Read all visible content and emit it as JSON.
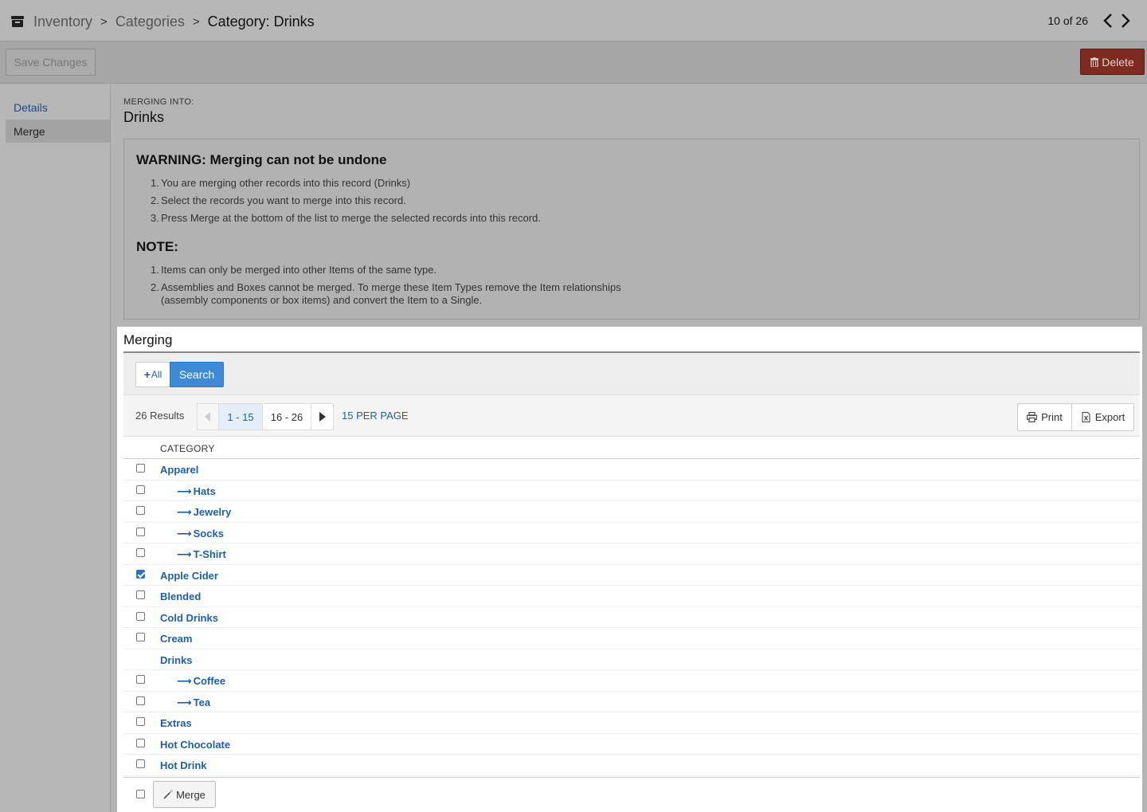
{
  "breadcrumb": {
    "items": [
      "Inventory",
      "Categories"
    ],
    "separator": ">",
    "current": "Category: Drinks"
  },
  "record_pager": {
    "text": "10 of 26"
  },
  "toolbar": {
    "save_label": "Save Changes",
    "delete_label": "Delete"
  },
  "sidebar": {
    "items": [
      {
        "label": "Details"
      },
      {
        "label": "Merge"
      }
    ]
  },
  "main": {
    "label": "MERGING INTO:",
    "title": "Drinks"
  },
  "warning": {
    "heading": "WARNING: Merging can not be undone",
    "steps": [
      "You are merging other records into this record (Drinks)",
      "Select the records you want to merge into this record.",
      "Press Merge at the bottom of the list to merge the selected records into this record."
    ],
    "note_heading": "NOTE:",
    "notes": [
      "Items can only be merged into other Items of the same type.",
      "Assemblies and Boxes cannot be merged. To merge these Item Types remove the Item relationships (assembly components or box items) and convert the Item to a Single."
    ]
  },
  "merging": {
    "title": "Merging",
    "add_all": "All",
    "search": "Search",
    "results_count": "26 Results",
    "pages": [
      "1 - 15",
      "16 - 26"
    ],
    "per_page": "15 PER PAGE",
    "print": "Print",
    "export": "Export",
    "column_header": "CATEGORY",
    "rows": [
      {
        "label": "Apparel",
        "child": false,
        "checked": false,
        "checkbox": true
      },
      {
        "label": "Hats",
        "child": true,
        "checked": false,
        "checkbox": true
      },
      {
        "label": "Jewelry",
        "child": true,
        "checked": false,
        "checkbox": true
      },
      {
        "label": "Socks",
        "child": true,
        "checked": false,
        "checkbox": true
      },
      {
        "label": "T-Shirt",
        "child": true,
        "checked": false,
        "checkbox": true
      },
      {
        "label": "Apple Cider",
        "child": false,
        "checked": true,
        "checkbox": true
      },
      {
        "label": "Blended",
        "child": false,
        "checked": false,
        "checkbox": true
      },
      {
        "label": "Cold Drinks",
        "child": false,
        "checked": false,
        "checkbox": true
      },
      {
        "label": "Cream",
        "child": false,
        "checked": false,
        "checkbox": true
      },
      {
        "label": "Drinks",
        "child": false,
        "checked": false,
        "checkbox": false
      },
      {
        "label": "Coffee",
        "child": true,
        "checked": false,
        "checkbox": true
      },
      {
        "label": "Tea",
        "child": true,
        "checked": false,
        "checkbox": true
      },
      {
        "label": "Extras",
        "child": false,
        "checked": false,
        "checkbox": true
      },
      {
        "label": "Hot Chocolate",
        "child": false,
        "checked": false,
        "checkbox": true
      },
      {
        "label": "Hot Drink",
        "child": false,
        "checked": false,
        "checkbox": true
      }
    ],
    "child_arrow": "⟶",
    "merge_button": "Merge"
  },
  "icons": {
    "breadcrumb": "archive-box-icon",
    "prev": "chevron-left-icon",
    "next": "chevron-right-icon",
    "delete": "trash-icon",
    "print": "printer-icon",
    "export": "excel-file-icon",
    "merge": "magic-wand-icon"
  },
  "colors": {
    "link": "#1f5fa5",
    "primary": "#3d8ad6",
    "danger": "#7d2a21",
    "overlay": "#b4b4b4"
  }
}
